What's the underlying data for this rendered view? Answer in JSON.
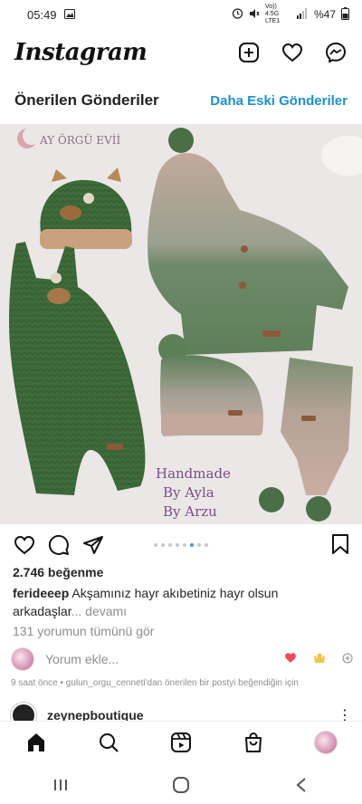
{
  "status_bar": {
    "time": "05:49",
    "network": "Vo)) 4.5G LTE1",
    "battery": "%47"
  },
  "header": {
    "logo_text": "Instagram"
  },
  "suggested": {
    "title": "Önerilen Gönderiler",
    "older_link": "Daha Eski Gönderiler"
  },
  "post": {
    "image_texts": {
      "brand": "AY ÖRGÜ EVİİ",
      "handmade": "Handmade",
      "by_ayla": "By Ayla",
      "by_arzu": "By Arzu"
    },
    "carousel_count": 8,
    "carousel_active": 6,
    "likes": "2.746 beğenme",
    "caption_user": "ferideeep",
    "caption_text": "Akşamınız hayr akıbetiniz hayr olsun arkadaşlar",
    "caption_more": "... devamı",
    "comments_link": "131 yorumun tümünü gör",
    "comment_placeholder": "Yorum ekle...",
    "meta": "9 saat önce • gulun_orgu_cenneti'dan önerilen bir postyi beğendiğin için"
  },
  "next_post": {
    "username": "zeynepboutique"
  },
  "colors": {
    "link_blue": "#1c8fd6",
    "heart_red": "#ed4956",
    "knit_green": "#3e6b3a",
    "knit_beige": "#c2a99c"
  },
  "icons": {
    "header": [
      "add-post-icon",
      "heart-icon",
      "messenger-icon"
    ],
    "actions": [
      "like-icon",
      "comment-icon",
      "share-icon",
      "bookmark-icon"
    ],
    "bottom_nav": [
      "home-icon",
      "search-icon",
      "reels-icon",
      "shop-icon",
      "profile-avatar"
    ],
    "system_nav": [
      "recent-apps-icon",
      "home-circle-icon",
      "back-icon"
    ]
  }
}
